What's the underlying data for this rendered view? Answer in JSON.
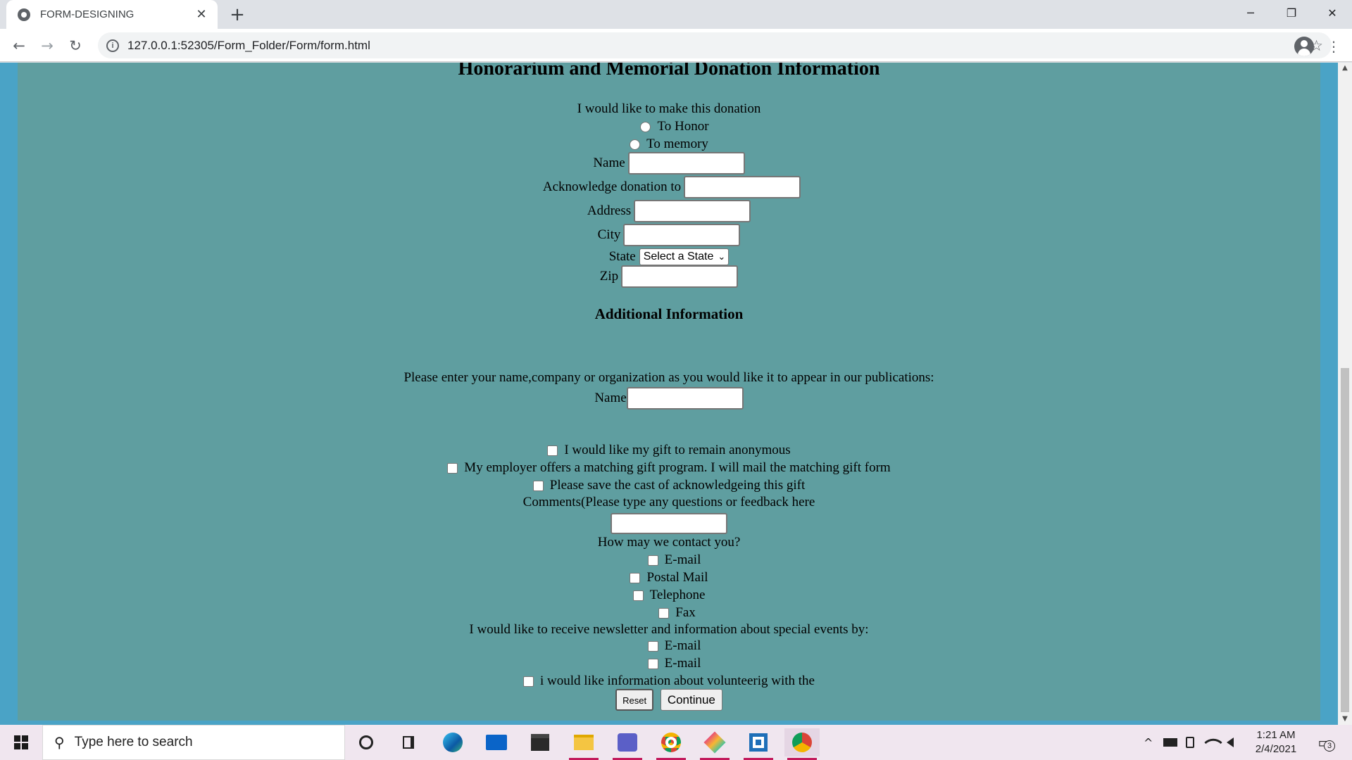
{
  "browser": {
    "tab_title": "FORM-DESIGNING",
    "tab_close": "✕",
    "new_tab": "+",
    "url": "127.0.0.1:52305/Form_Folder/Form/form.html",
    "info_glyph": "i",
    "minimize": "─",
    "restore": "❐",
    "close": "✕",
    "back": "←",
    "forward": "→",
    "reload": "↻",
    "star": "☆",
    "menu": "⋮"
  },
  "form": {
    "title": "Honorarium and Memorial Donation Information",
    "donation_prompt": "I would like to make this donation",
    "radio_honor": "To Honor",
    "radio_memory": "To memory",
    "name_label": "Name",
    "ack_label": "Acknowledge donation to",
    "address_label": "Address",
    "city_label": "City",
    "state_label": "State",
    "state_select": "Select a State",
    "zip_label": "Zip",
    "additional_heading": "Additional Information",
    "publication_prompt": "Please enter your name,company or organization as you would like it to appear in our publications:",
    "pub_name_label": "Name",
    "check_anonymous": "I would like my gift to remain anonymous",
    "check_employer": "My employer offers a matching gift program. I will mail the matching gift form",
    "check_save": "Please save the cast of acknowledgeing this gift",
    "comments_label": "Comments(Please type any questions or feedback here",
    "contact_prompt": "How may we contact you?",
    "contact_email": "E-mail",
    "contact_postal": "Postal Mail",
    "contact_phone": "Telephone",
    "contact_fax": "Fax",
    "newsletter_prompt": "I would like to receive newsletter and information about special events by:",
    "news_email_1": "E-mail",
    "news_email_2": "E-mail",
    "volunteer": "i would like information about volunteerig with the",
    "reset_button": "Reset",
    "continue_button": "Continue"
  },
  "scrollbar": {
    "up": "▲",
    "down": "▼"
  },
  "taskbar": {
    "search_placeholder": "Type here to search",
    "search_glyph": "⚲",
    "time": "1:21 AM",
    "date": "2/4/2021",
    "notification_count": "3",
    "tray_chevron": "^",
    "notif_glyph": "▭"
  },
  "colors": {
    "page_background": "#4aa3c6",
    "form_background": "#5f9ea0",
    "taskbar_background": "#f0e6ef",
    "app_underline": "#c2185b"
  }
}
